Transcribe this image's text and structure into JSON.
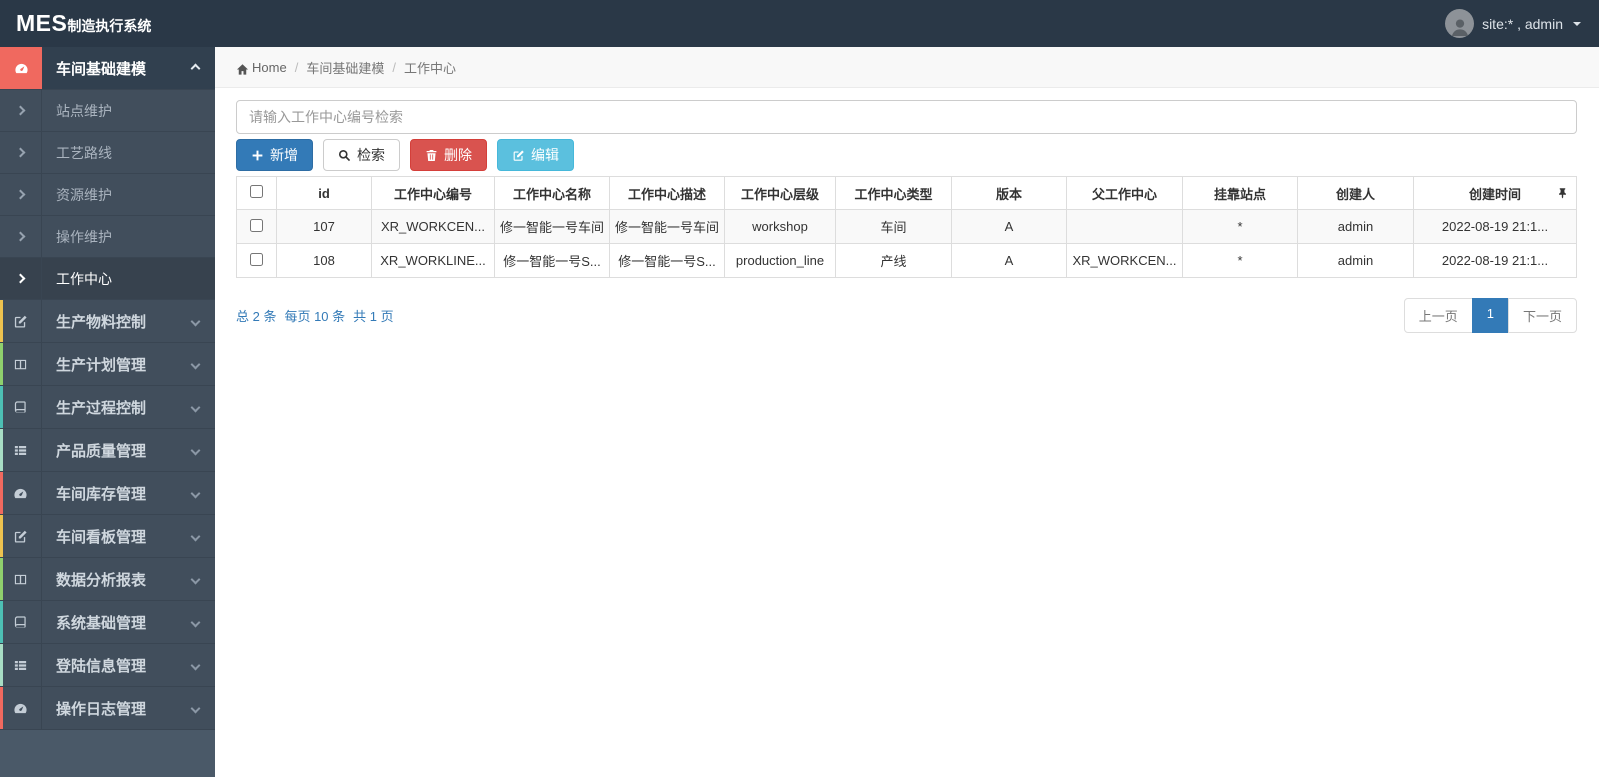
{
  "navbar": {
    "brand_mes": "MES",
    "brand_rest": "制造执行系统",
    "user_label": "site:* , admin"
  },
  "breadcrumb": {
    "home": "Home",
    "items": [
      "车间基础建模",
      "工作中心"
    ]
  },
  "sidebar": {
    "active_parent": {
      "label": "车间基础建模",
      "icon": "tachometer-icon"
    },
    "sub_items": [
      {
        "label": "站点维护",
        "active": false
      },
      {
        "label": "工艺路线",
        "active": false
      },
      {
        "label": "资源维护",
        "active": false
      },
      {
        "label": "操作维护",
        "active": false
      },
      {
        "label": "工作中心",
        "active": true
      }
    ],
    "parents": [
      {
        "label": "生产物料控制",
        "icon": "edit-icon"
      },
      {
        "label": "生产计划管理",
        "icon": "columns-icon"
      },
      {
        "label": "生产过程控制",
        "icon": "book-icon"
      },
      {
        "label": "产品质量管理",
        "icon": "list-icon"
      },
      {
        "label": "车间库存管理",
        "icon": "tachometer-icon"
      },
      {
        "label": "车间看板管理",
        "icon": "edit-icon"
      },
      {
        "label": "数据分析报表",
        "icon": "columns-icon"
      },
      {
        "label": "系统基础管理",
        "icon": "book-icon"
      },
      {
        "label": "登陆信息管理",
        "icon": "list-icon"
      },
      {
        "label": "操作日志管理",
        "icon": "tachometer-icon"
      }
    ]
  },
  "search": {
    "placeholder": "请输入工作中心编号检索",
    "value": ""
  },
  "toolbar": {
    "add_label": "新增",
    "search_label": "检索",
    "delete_label": "删除",
    "edit_label": "编辑"
  },
  "table": {
    "headers": [
      "id",
      "工作中心编号",
      "工作中心名称",
      "工作中心描述",
      "工作中心层级",
      "工作中心类型",
      "版本",
      "父工作中心",
      "挂靠站点",
      "创建人",
      "创建时间"
    ],
    "rows": [
      [
        "107",
        "XR_WORKCEN...",
        "修一智能一号车间",
        "修一智能一号车间",
        "workshop",
        "车间",
        "A",
        "",
        "*",
        "admin",
        "2022-08-19 21:1..."
      ],
      [
        "108",
        "XR_WORKLINE...",
        "修一智能一号S...",
        "修一智能一号S...",
        "production_line",
        "产线",
        "A",
        "XR_WORKCEN...",
        "*",
        "admin",
        "2022-08-19 21:1..."
      ]
    ]
  },
  "pagination": {
    "summary_total": "总 2 条",
    "summary_per_page": "每页 10 条",
    "summary_pages": "共 1 页",
    "prev_label": "上一页",
    "current_page": "1",
    "next_label": "下一页"
  },
  "colors": {
    "navbar_bg": "#2a3847",
    "sidebar_bg": "#414e5c",
    "accent_red": "#f0695f",
    "primary_blue": "#337ab7",
    "danger_red": "#d9534f",
    "info_blue": "#5bc0de",
    "stripe_palette": [
      "#edc24f",
      "#8fd06d",
      "#4dbfb4",
      "#a8ddc4",
      "#f0695f"
    ]
  }
}
